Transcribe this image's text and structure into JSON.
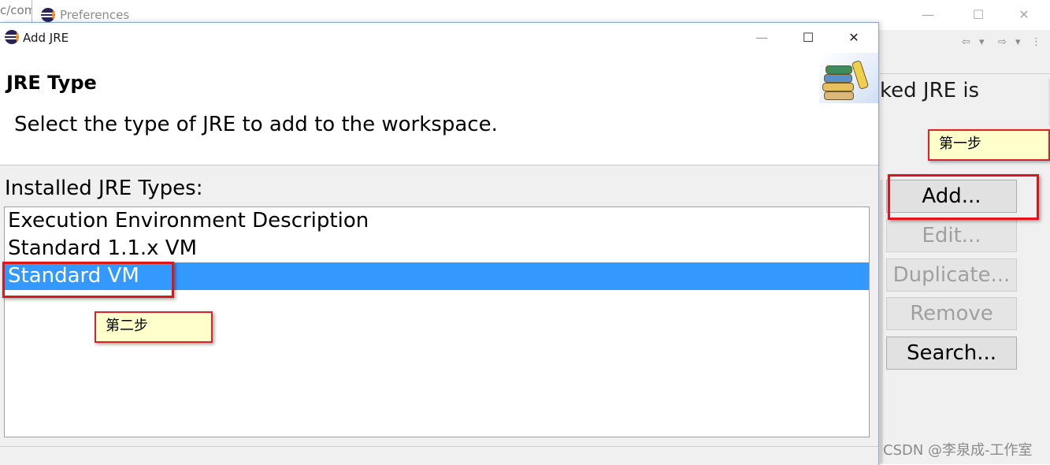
{
  "background": {
    "url_fragment": "c/com",
    "preferences_window": {
      "title": "Preferences",
      "controls": {
        "minimize": "—",
        "maximize": "☐",
        "close": "✕"
      },
      "toolbar": {
        "back": "⇦",
        "back_menu": "▾",
        "forward": "⇨",
        "forward_menu": "▾",
        "more": "⋮"
      },
      "partial_text": "ked JRE is",
      "buttons": [
        {
          "label": "Add...",
          "enabled": true
        },
        {
          "label": "Edit...",
          "enabled": false
        },
        {
          "label": "Duplicate...",
          "enabled": false
        },
        {
          "label": "Remove",
          "enabled": false
        },
        {
          "label": "Search...",
          "enabled": true
        }
      ]
    }
  },
  "dialog": {
    "title": "Add JRE",
    "controls": {
      "minimize": "—",
      "maximize": "☐",
      "close": "✕"
    },
    "banner": {
      "title": "JRE Type",
      "description": "Select the type of JRE to add to the workspace."
    },
    "list_label": "Installed JRE Types:",
    "jre_types": [
      {
        "label": "Execution Environment Description",
        "selected": false
      },
      {
        "label": "Standard 1.1.x VM",
        "selected": false
      },
      {
        "label": "Standard VM",
        "selected": true
      }
    ]
  },
  "annotations": {
    "step1": "第一步",
    "step2": "第二步",
    "highlight_color": "#e0151b",
    "callout_bg": "#ffffcc"
  },
  "watermark": "CSDN @李泉成-工作室",
  "colors": {
    "selection": "#3399ff",
    "dialog_bg": "#f0f0f0",
    "disabled_text": "#a0a0a0"
  }
}
